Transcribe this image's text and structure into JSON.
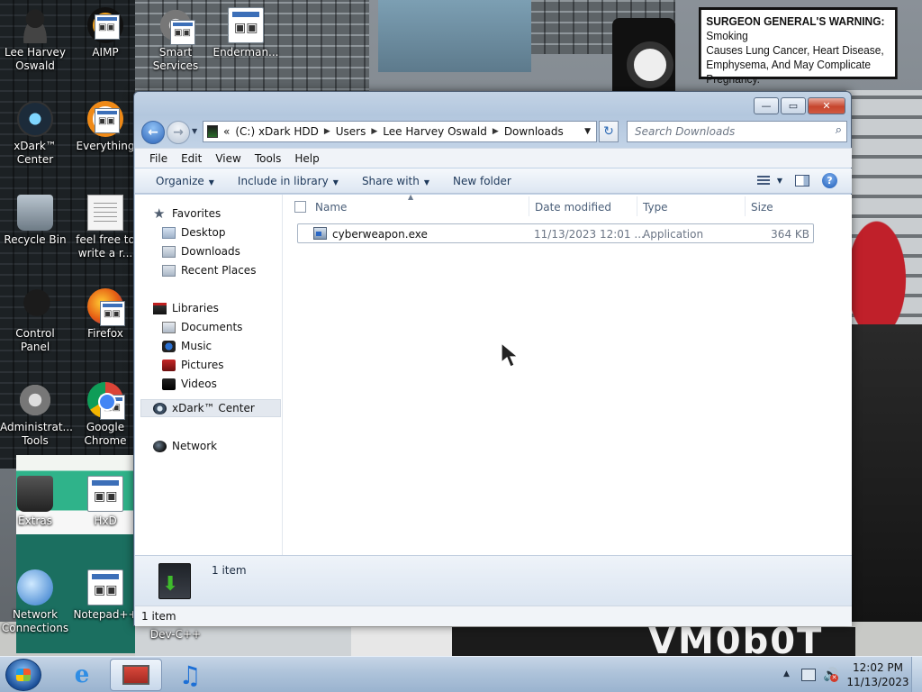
{
  "warning_sign": {
    "line1_bold": "SURGEON GENERAL'S WARNING:",
    "line1_rest": " Smoking",
    "line2": "Causes Lung Cancer, Heart Disease,",
    "line3": "Emphysema, And May Complicate Pregnancy."
  },
  "wallpaper": {
    "bottom_text": "VM0b0T"
  },
  "desktop_icons": [
    {
      "label": "Lee Harvey Oswald"
    },
    {
      "label": "AIMP"
    },
    {
      "label": "Smart Services"
    },
    {
      "label": "Enderman..."
    },
    {
      "label": "xDark™ Center"
    },
    {
      "label": "Everything"
    },
    {
      "label": "Recycle Bin"
    },
    {
      "label": "feel free to write a r..."
    },
    {
      "label": "Control Panel"
    },
    {
      "label": "Firefox"
    },
    {
      "label": "Administrat... Tools"
    },
    {
      "label": "Google Chrome"
    },
    {
      "label": "Extras"
    },
    {
      "label": "HxD"
    },
    {
      "label": "Network Connections"
    },
    {
      "label": "Notepad++"
    },
    {
      "label": "Dev-C++"
    }
  ],
  "window": {
    "controls": {
      "minimize": "—",
      "maximize": "▭",
      "close": "✕"
    },
    "address": {
      "overflow": "«",
      "crumbs": [
        "(C:) xDark HDD",
        "Users",
        "Lee Harvey Oswald",
        "Downloads"
      ]
    },
    "search": {
      "placeholder": "Search Downloads"
    },
    "menu": [
      "File",
      "Edit",
      "View",
      "Tools",
      "Help"
    ],
    "commands": {
      "organize": "Organize",
      "include_in_library": "Include in library",
      "share_with": "Share with",
      "new_folder": "New folder"
    },
    "nav_pane": {
      "favorites": "Favorites",
      "favorites_items": [
        "Desktop",
        "Downloads",
        "Recent Places"
      ],
      "libraries": "Libraries",
      "libraries_items": [
        "Documents",
        "Music",
        "Pictures",
        "Videos"
      ],
      "xdark_center": "xDark™ Center",
      "network": "Network"
    },
    "columns": {
      "name": "Name",
      "date_modified": "Date modified",
      "type": "Type",
      "size": "Size"
    },
    "files": [
      {
        "name": "cyberweapon.exe",
        "date_modified": "11/13/2023 12:01 ...",
        "type": "Application",
        "size": "364 KB"
      }
    ],
    "details_pane": {
      "text": "1 item"
    },
    "status_bar": {
      "text": "1 item"
    }
  },
  "taskbar": {
    "clock": {
      "time": "12:02 PM",
      "date": "11/13/2023"
    }
  }
}
